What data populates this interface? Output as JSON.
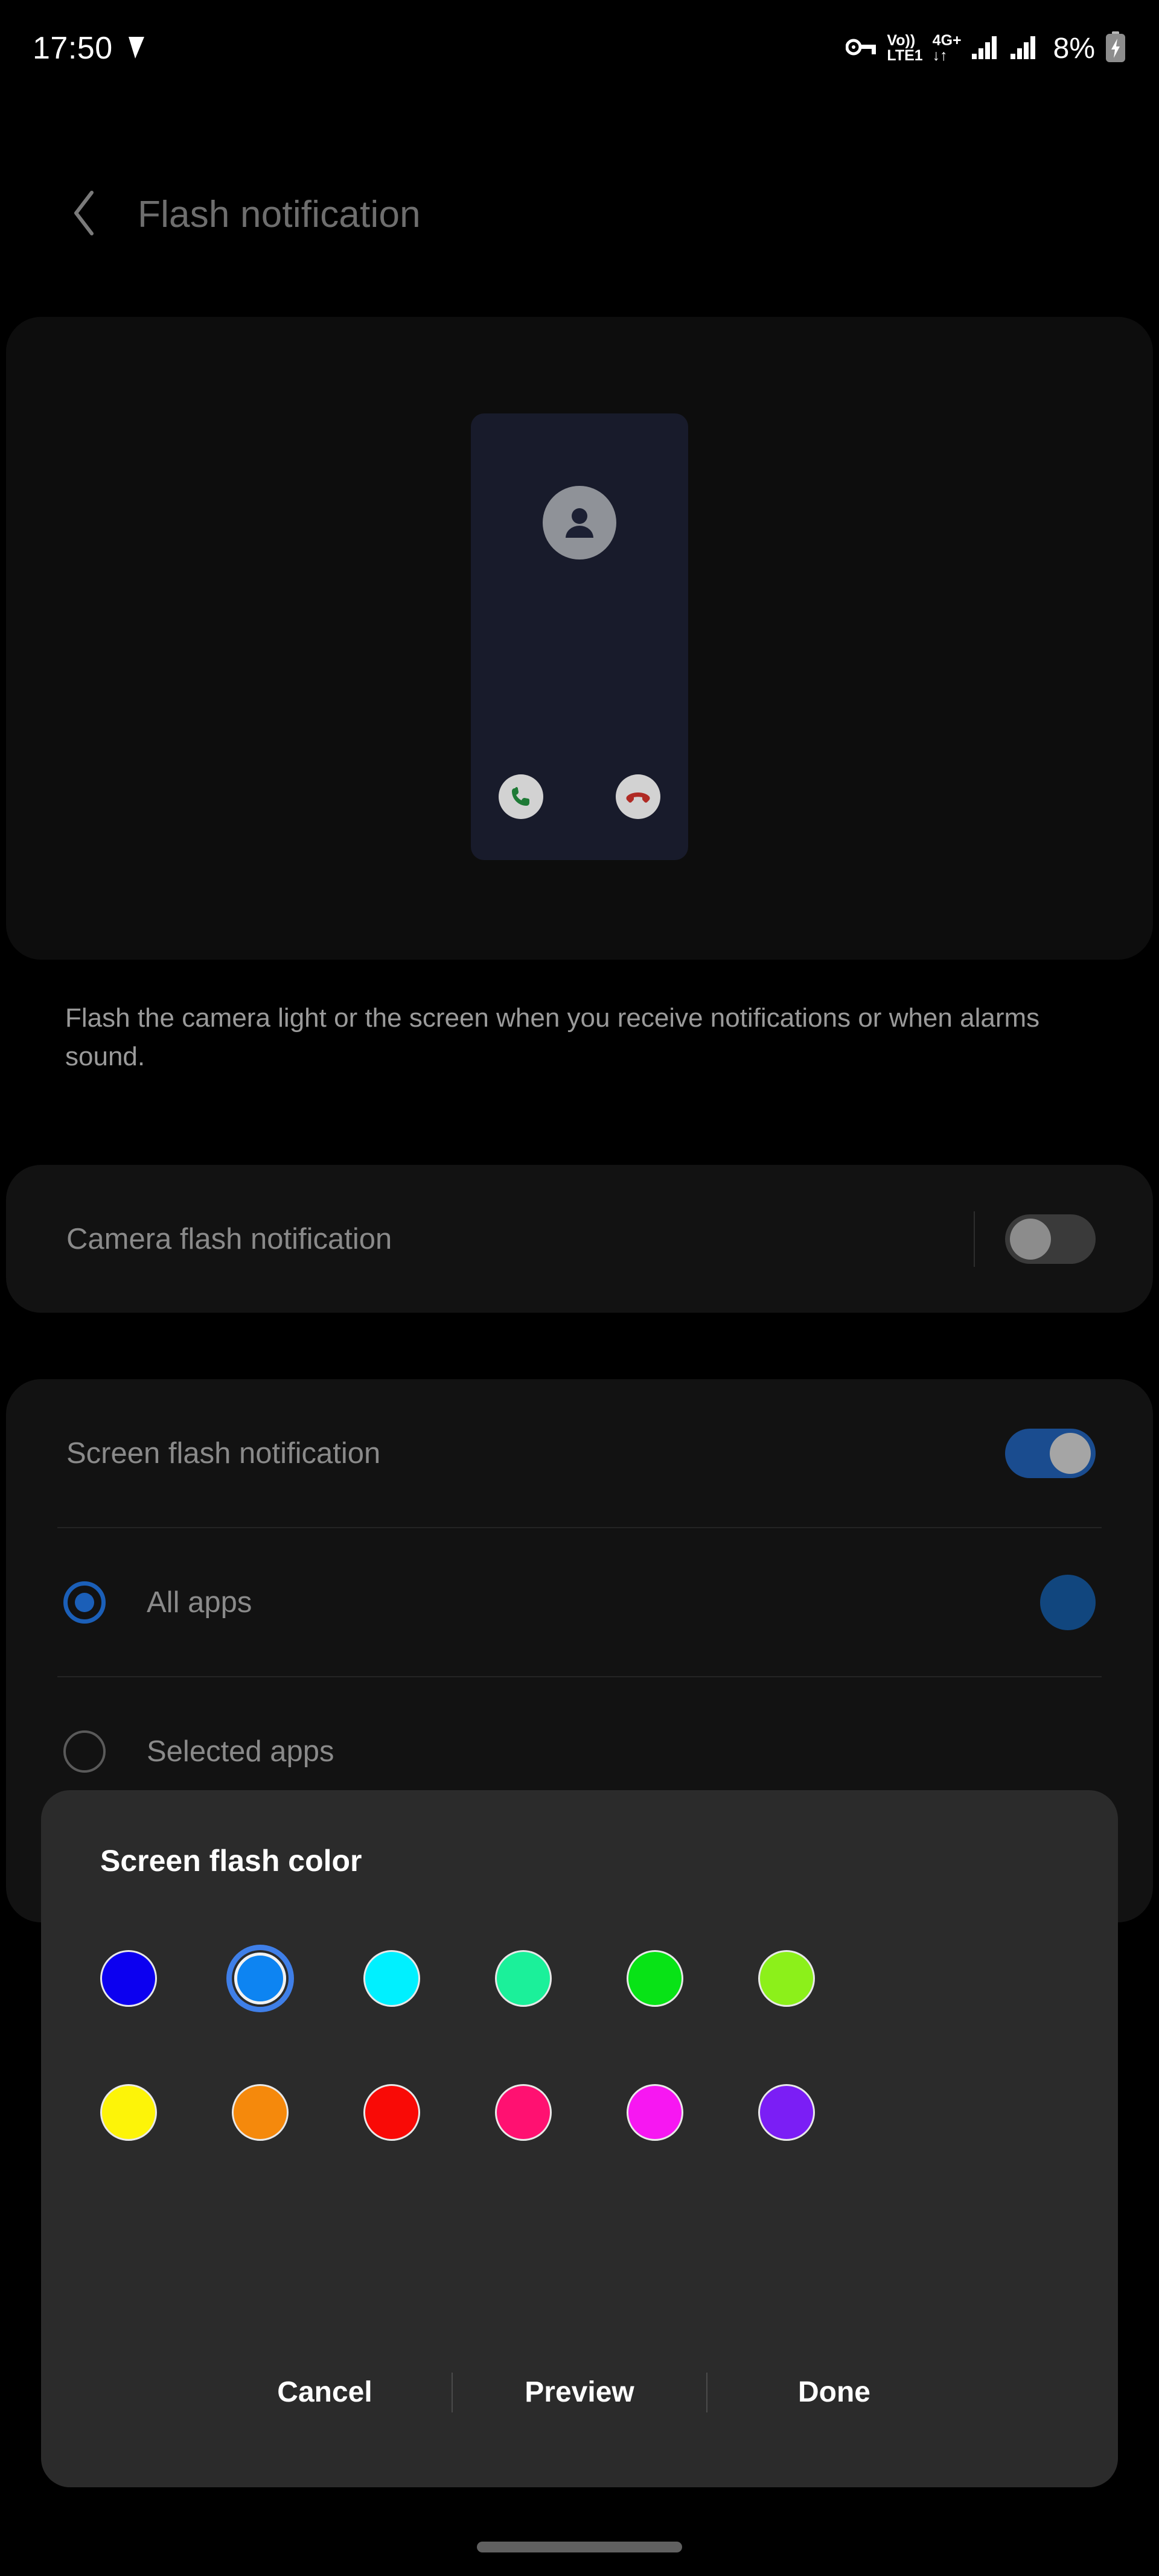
{
  "status_bar": {
    "time": "17:50",
    "location_icon": "location-arrow-icon",
    "vpn_key_icon": "vpn-key-icon",
    "volte_line1": "Vo))",
    "volte_line2": "LTE1",
    "network_type": "4G+",
    "data_arrows": "↓↑",
    "signal_1": "signal-bars-icon",
    "signal_2": "signal-bars-icon",
    "battery_percent": "8%",
    "battery_icon": "battery-charging-icon"
  },
  "header": {
    "back_icon": "chevron-left-icon",
    "title": "Flash notification"
  },
  "preview": {
    "avatar_icon": "person-avatar-icon",
    "answer_icon": "phone-answer-icon",
    "decline_icon": "phone-decline-icon"
  },
  "description": "Flash the camera light or the screen when you receive notifications or when alarms sound.",
  "settings": {
    "camera_flash": {
      "label": "Camera flash notification",
      "enabled": false
    },
    "screen_flash": {
      "label": "Screen flash notification",
      "enabled": true,
      "options": [
        {
          "label": "All apps",
          "selected": true,
          "color": "#11467e"
        },
        {
          "label": "Selected apps",
          "selected": false,
          "color": null
        }
      ]
    }
  },
  "dialog": {
    "title": "Screen flash color",
    "colors": [
      [
        {
          "name": "blue",
          "hex": "#0c00f0",
          "selected": false
        },
        {
          "name": "azure",
          "hex": "#0d84f2",
          "selected": true
        },
        {
          "name": "cyan",
          "hex": "#00f0ff",
          "selected": false
        },
        {
          "name": "spring-green",
          "hex": "#1bf09a",
          "selected": false
        },
        {
          "name": "green",
          "hex": "#08e316",
          "selected": false
        },
        {
          "name": "lime",
          "hex": "#8cf01a",
          "selected": false
        }
      ],
      [
        {
          "name": "yellow",
          "hex": "#fdf408",
          "selected": false
        },
        {
          "name": "orange",
          "hex": "#f5890c",
          "selected": false
        },
        {
          "name": "red",
          "hex": "#f90a06",
          "selected": false
        },
        {
          "name": "pink",
          "hex": "#ff1171",
          "selected": false
        },
        {
          "name": "magenta",
          "hex": "#f717f2",
          "selected": false
        },
        {
          "name": "violet",
          "hex": "#7b1ef5",
          "selected": false
        }
      ]
    ],
    "buttons": {
      "cancel": "Cancel",
      "preview": "Preview",
      "done": "Done"
    }
  },
  "nav_bar": {
    "home_indicator": "home-gesture-bar"
  }
}
